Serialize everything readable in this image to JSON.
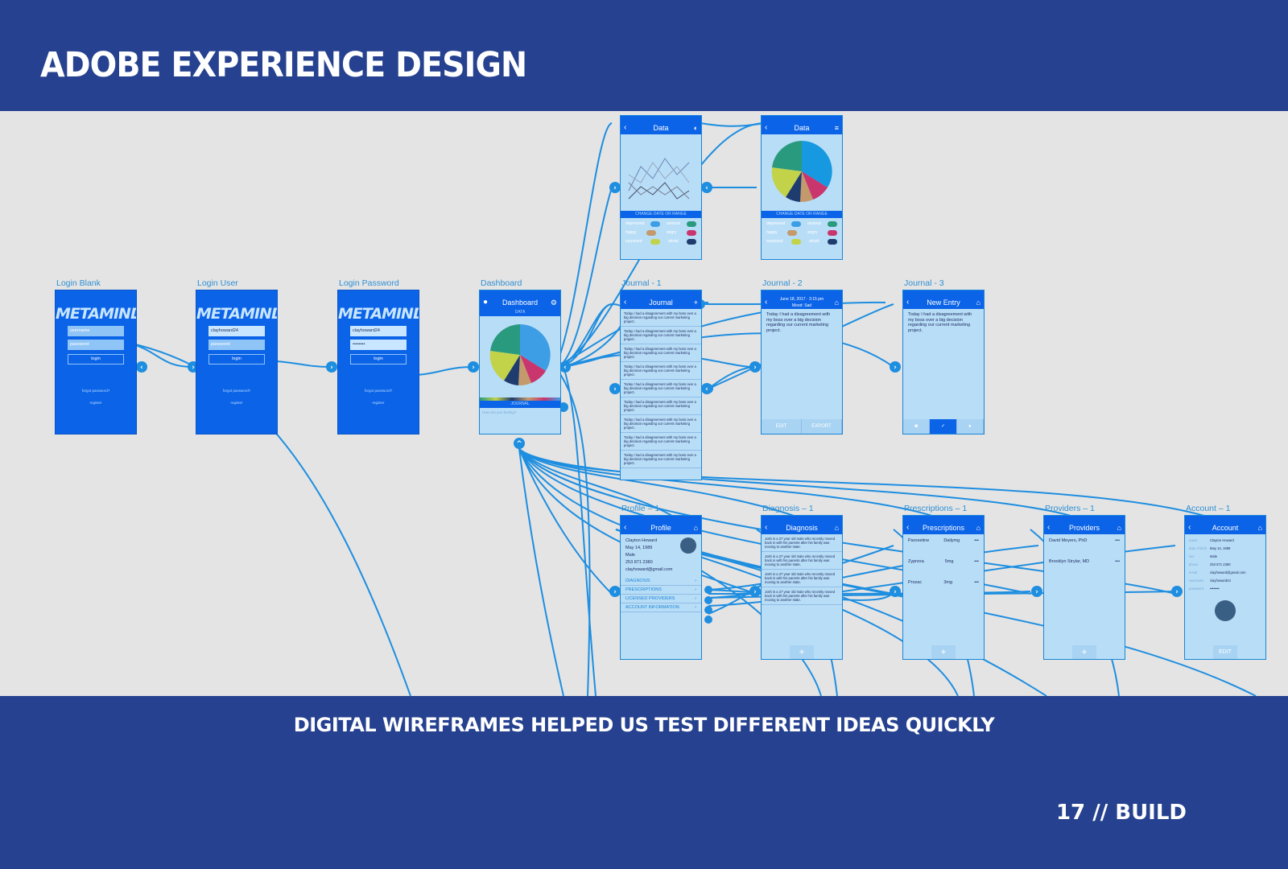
{
  "header": {
    "title": "ADOBE EXPERIENCE DESIGN"
  },
  "artboards": {
    "login_blank": {
      "label": "Login Blank",
      "logo": "METAMIND",
      "username_placeholder": "username",
      "password_placeholder": "password",
      "button": "login",
      "forgot": "forgot password?",
      "register": "register"
    },
    "login_user": {
      "label": "Login User",
      "logo": "METAMIND",
      "username": "clayhoward24",
      "password_placeholder": "password",
      "button": "login",
      "forgot": "forgot password?",
      "register": "register"
    },
    "login_password": {
      "label": "Login Password",
      "logo": "METAMIND",
      "username": "clayhoward24",
      "password": "••••••••",
      "button": "login",
      "forgot": "forgot password?",
      "register": "register"
    },
    "dashboard": {
      "label": "Dashboard",
      "title": "Dashboard",
      "data_bar": "DATA",
      "journal_bar": "JOURNAL",
      "hint": "How are you feeling?"
    },
    "data_line": {
      "title": "Data",
      "change_bar": "CHANGE DATE OR RANGE",
      "toggles": [
        "depressed",
        "anxious",
        "happy",
        "angry",
        "surprised",
        "afraid"
      ]
    },
    "data_pie": {
      "title": "Data",
      "change_bar": "CHANGE DATE OR RANGE",
      "toggles": [
        "depressed",
        "anxious",
        "happy",
        "angry",
        "surprised",
        "afraid"
      ]
    },
    "journal1": {
      "label": "Journal - 1",
      "title": "Journal",
      "entry_text": "Today I had a disagreement with my boss over a big decision regarding our current marketing project."
    },
    "journal2": {
      "label": "Journal - 2",
      "title": "June 18, 2017 · 3:15 pm",
      "subtitle": "Mood: Sad",
      "text": "Today I had a disagreement with my boss over a big decision regarding our current marketing project.",
      "edit": "EDIT",
      "export": "EXPORT"
    },
    "journal3": {
      "label": "Journal - 3",
      "title": "New Entry",
      "text": "Today I had a disagreement with my boss over a big decision regarding our current marketing project."
    },
    "profile": {
      "label": "Profile – 1",
      "title": "Profile",
      "name": "Clayton Howard",
      "dob": "May 14, 1989",
      "sex": "Male",
      "phone": "253 871 2380",
      "email": "clayhoward@gmail.com",
      "links": [
        "DIAGNOSIS",
        "PRESCRIPTIONS",
        "LICENSED PROVIDERS",
        "ACCOUNT INFORMATION"
      ]
    },
    "diagnosis": {
      "label": "Diagnosis – 1",
      "title": "Diagnosis",
      "text": "Josh is a 27 year old male who recently moved back in with his parents after his family was moving to another state."
    },
    "prescriptions": {
      "label": "Prescriptions – 1",
      "title": "Prescriptions",
      "items": [
        {
          "name": "Paroxetine",
          "dose": "Dailymg"
        },
        {
          "name": "Zyprexa",
          "dose": "5mg"
        },
        {
          "name": "Prozac",
          "dose": "3mg"
        }
      ]
    },
    "providers": {
      "label": "Providers – 1",
      "title": "Providers",
      "items": [
        "David Meyers, PhD",
        "Brooklyn Strylar, MD"
      ]
    },
    "account": {
      "label": "Account – 1",
      "title": "Account",
      "fields": [
        {
          "k": "name",
          "v": "Clayton Howard"
        },
        {
          "k": "date of birth",
          "v": "May 14, 1989"
        },
        {
          "k": "sex",
          "v": "Male"
        },
        {
          "k": "phone",
          "v": "253 871 2380"
        },
        {
          "k": "email",
          "v": "clayhoward@gmail.com"
        },
        {
          "k": "username",
          "v": "clayhoward24"
        },
        {
          "k": "password",
          "v": "••••••••"
        }
      ],
      "edit": "EDIT"
    }
  },
  "pie_percents": [
    "33%",
    "31%",
    "13%",
    "9%",
    "8%",
    "6%"
  ],
  "footer": {
    "caption": "DIGITAL WIREFRAMES HELPED US TEST DIFFERENT IDEAS QUICKLY",
    "page": "17 // BUILD"
  }
}
